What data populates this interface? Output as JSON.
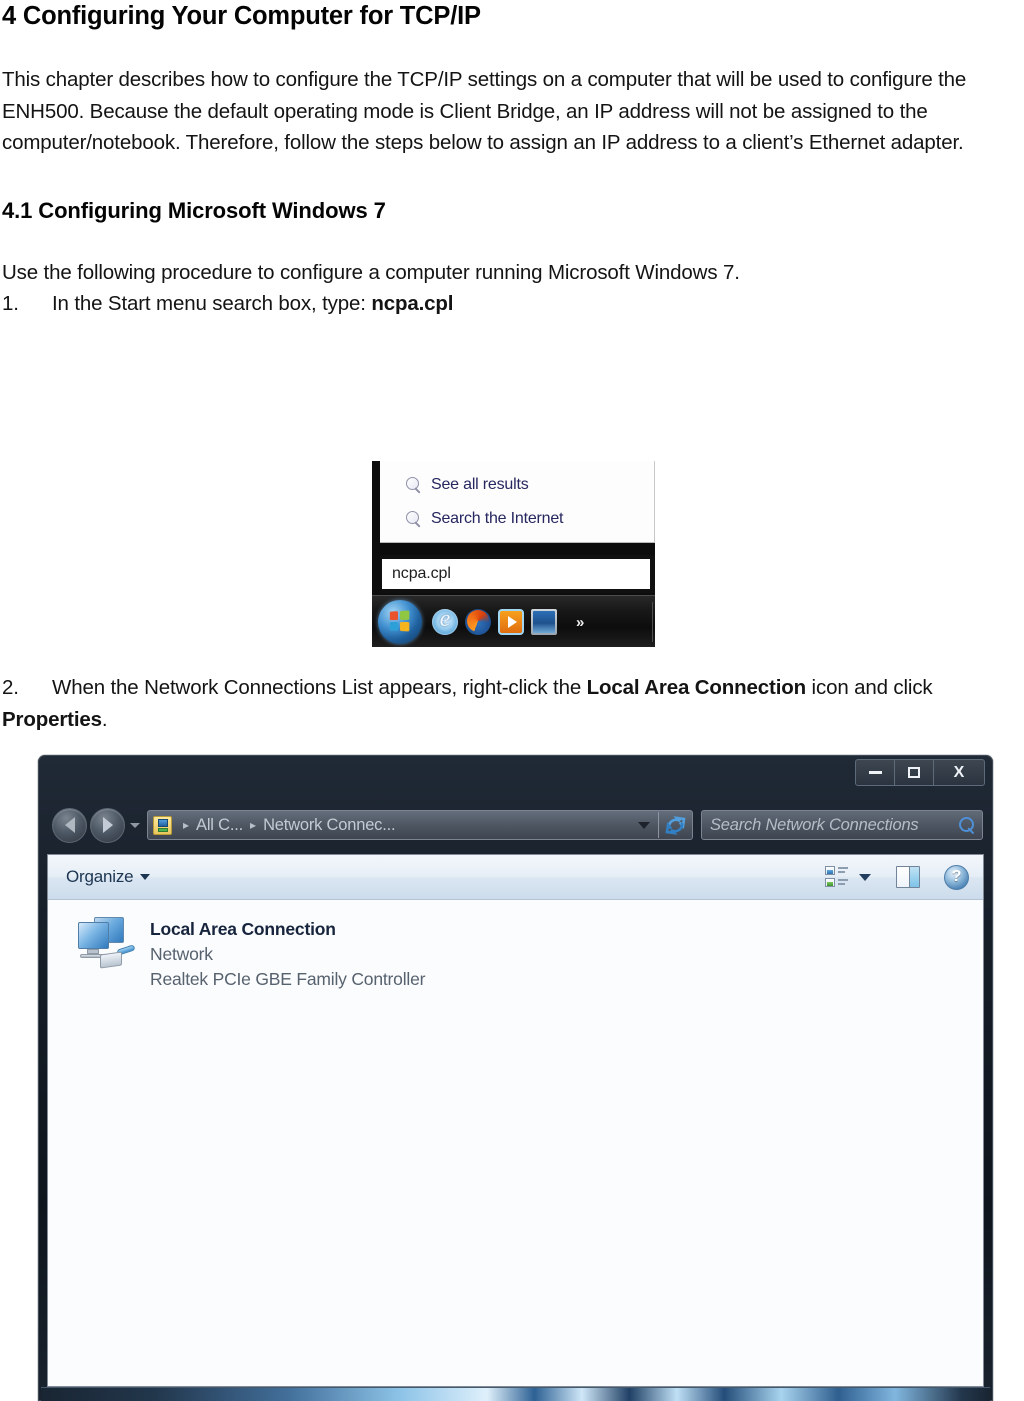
{
  "document": {
    "chapter_heading": "4 Configuring Your Computer for TCP/IP",
    "intro_paragraph": "This chapter describes how to configure the TCP/IP settings on a computer that will be used to configure the ENH500. Because the default operating mode is Client Bridge, an IP address will not be assigned to the computer/notebook. Therefore, follow the steps below to assign an IP address to a client’s Ethernet adapter.",
    "section_heading": "4.1 Configuring Microsoft Windows 7",
    "section_intro": "Use the following procedure to configure a computer running Microsoft Windows 7.",
    "steps": [
      {
        "number": "1.",
        "text_before": "In the Start menu search box, type: ",
        "bold_text": "ncpa.cpl",
        "text_after": ""
      },
      {
        "number": "2.",
        "text_before": "When the Network Connections List appears, right-click the ",
        "bold_text": "Local Area Connection",
        "text_mid": " icon and click ",
        "bold_text2": "Properties",
        "text_after": "."
      }
    ]
  },
  "figure_start_menu": {
    "results": [
      {
        "icon": "search-icon",
        "label": "See all results"
      },
      {
        "icon": "search-icon",
        "label": "Search the Internet"
      }
    ],
    "search_box_value": "ncpa.cpl",
    "taskbar": {
      "start_orb": "windows-start-orb",
      "icons": [
        {
          "name": "internet-explorer-icon",
          "glyph": "e"
        },
        {
          "name": "firefox-icon",
          "glyph": ""
        },
        {
          "name": "windows-media-player-icon",
          "glyph": ""
        },
        {
          "name": "show-desktop-icon",
          "glyph": ""
        }
      ],
      "overflow_label": "»"
    }
  },
  "figure_explorer": {
    "window_controls": {
      "minimize": "–",
      "maximize": "□",
      "close": "X"
    },
    "navigation": {
      "back": "back-button",
      "forward": "forward-button",
      "recent_dropdown": "recent-pages-dropdown"
    },
    "address_bar": {
      "icon": "network-connections-icon",
      "crumbs": [
        "All C...",
        "Network Connec..."
      ],
      "separator": "▸",
      "dropdown": "address-dropdown",
      "refresh": "refresh-button"
    },
    "search": {
      "placeholder": "Search Network Connections",
      "icon": "search-icon"
    },
    "toolbar": {
      "organize_label": "Organize",
      "organize_caret": "▼",
      "views_icon": "change-view-icon",
      "views_caret": "▼",
      "preview_pane_icon": "preview-pane-icon",
      "help_icon": "help-icon",
      "help_glyph": "?"
    },
    "items": [
      {
        "icon": "network-adapter-icon",
        "name": "Local Area Connection",
        "status": "Network",
        "adapter": "Realtek PCIe GBE Family Controller"
      }
    ]
  },
  "colors": {
    "window_chrome": "#121a24",
    "toolbar_gradient_top": "#f3f7fb",
    "toolbar_gradient_bottom": "#ccdcec",
    "link_blue": "#23235e",
    "accent_blue": "#4c8fd8",
    "text_primary": "#111111",
    "text_muted": "#55606d"
  }
}
